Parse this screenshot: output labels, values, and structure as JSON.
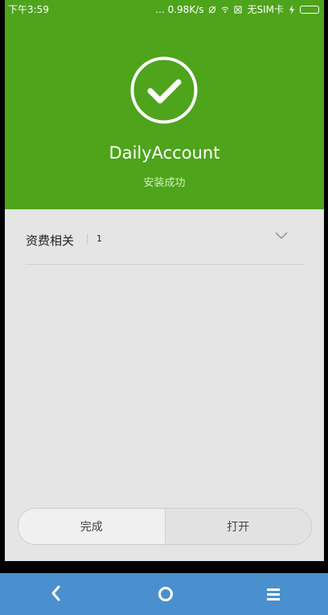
{
  "status_bar": {
    "time": "下午3:59",
    "network_speed": "... 0.98K/s",
    "sim_text": "无SIM卡"
  },
  "header": {
    "app_name": "DailyAccount",
    "status": "安装成功",
    "icon": "check-icon"
  },
  "permissions": {
    "label": "资费相关",
    "count": "1",
    "icon": "chevron-down-icon"
  },
  "actions": {
    "done_label": "完成",
    "open_label": "打开"
  },
  "nav": {
    "back_icon": "back-icon",
    "home_icon": "home-icon",
    "menu_icon": "menu-icon"
  },
  "colors": {
    "header_green": "#4ea41b",
    "nav_blue": "#4a90cf",
    "background": "#e5e5e5"
  }
}
